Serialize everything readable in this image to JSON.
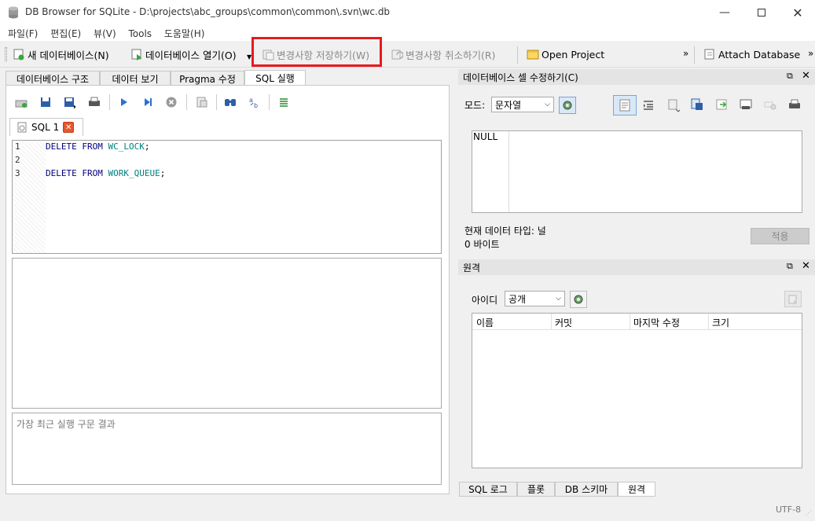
{
  "window": {
    "title": "DB Browser for SQLite - D:\\projects\\abc_groups\\common\\common\\.svn\\wc.db"
  },
  "menu": [
    "파일(F)",
    "편집(E)",
    "뷰(V)",
    "Tools",
    "도움말(H)"
  ],
  "toolbar": {
    "new_db": "새 데이터베이스(N)",
    "open_db": "데이터베이스 열기(O)",
    "write_changes": "변경사항 저장하기(W)",
    "revert_changes": "변경사항 취소하기(R)",
    "open_project": "Open Project",
    "attach_db": "Attach Database",
    "overflow": "»"
  },
  "main_tabs": [
    "데이터베이스 구조",
    "데이터 보기",
    "Pragma 수정",
    "SQL 실행"
  ],
  "sql_tab": {
    "label": "SQL 1"
  },
  "editor": {
    "lines": [
      {
        "n": "1",
        "kw1": "DELETE",
        "kw2": "FROM",
        "table": "WC_LOCK",
        "end": ";"
      },
      {
        "n": "2",
        "kw1": "",
        "kw2": "",
        "table": "",
        "end": ""
      },
      {
        "n": "3",
        "kw1": "DELETE",
        "kw2": "FROM",
        "table": "WORK_QUEUE",
        "end": ";"
      }
    ]
  },
  "result_message_placeholder": "가장 최근 실행 구문 결과",
  "cell_editor": {
    "title": "데이터베이스 셀 수정하기(C)",
    "mode_label": "모드:",
    "mode_value": "문자열",
    "content": "NULL",
    "type_info": "현재 데이터 타입: 널",
    "size_info": "0 바이트",
    "apply": "적용"
  },
  "remote": {
    "title": "원격",
    "identity_label": "아이디",
    "identity_value": "공개",
    "columns": [
      "이름",
      "커밋",
      "마지막 수정",
      "크기"
    ]
  },
  "bottom_tabs": [
    "SQL 로그",
    "플롯",
    "DB 스키마",
    "원격"
  ],
  "status": {
    "encoding": "UTF-8"
  },
  "colors": {
    "highlight": "#e8191f",
    "keyword": "#00007f",
    "table_name": "#008080"
  }
}
